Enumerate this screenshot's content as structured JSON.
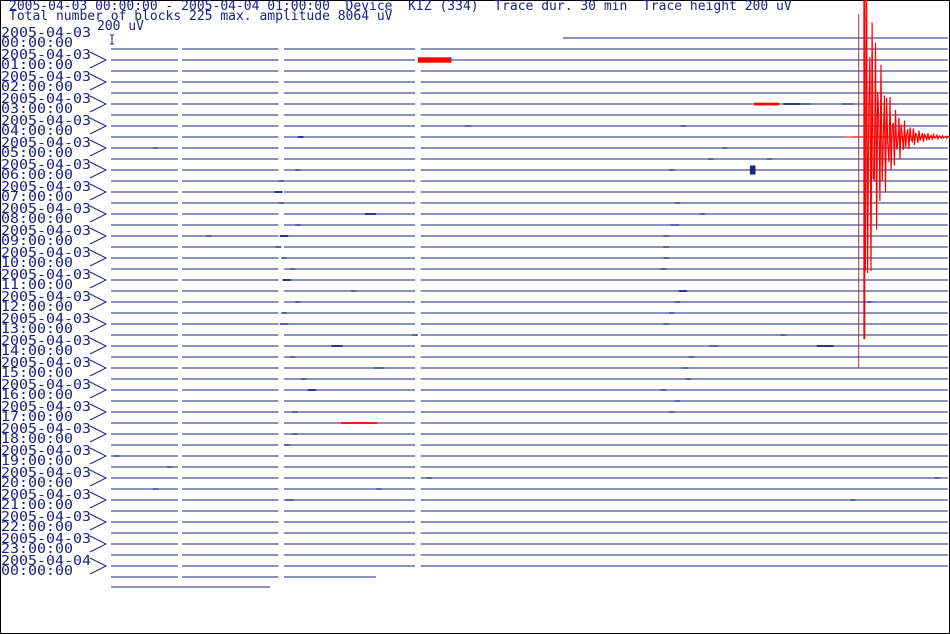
{
  "header": {
    "line1": "2005-04-03 00:00:00 - 2005-04-04 01:00:00  Device  KIZ (334)  Trace dur. 30 min  Trace height 200 uV",
    "line2": "Total number of blocks 225 max. amplitude 8064 uV"
  },
  "scale_bar": {
    "label": "200 uV"
  },
  "colors": {
    "trace": "#1a237e",
    "event": "#ff0000",
    "marker": "#a0304a",
    "text": "#1a237e",
    "frame": "#000000"
  },
  "chart_data": {
    "type": "line",
    "title": "",
    "xlabel": "",
    "ylabel": "",
    "trace_duration_min": 30,
    "trace_height_uV": 200,
    "xlim": [
      0,
      30
    ],
    "hour_labels": [
      [
        "2005-04-03",
        "00:00:00"
      ],
      [
        "2005-04-03",
        "01:00:00"
      ],
      [
        "2005-04-03",
        "02:00:00"
      ],
      [
        "2005-04-03",
        "03:00:00"
      ],
      [
        "2005-04-03",
        "04:00:00"
      ],
      [
        "2005-04-03",
        "05:00:00"
      ],
      [
        "2005-04-03",
        "06:00:00"
      ],
      [
        "2005-04-03",
        "07:00:00"
      ],
      [
        "2005-04-03",
        "08:00:00"
      ],
      [
        "2005-04-03",
        "09:00:00"
      ],
      [
        "2005-04-03",
        "10:00:00"
      ],
      [
        "2005-04-03",
        "11:00:00"
      ],
      [
        "2005-04-03",
        "12:00:00"
      ],
      [
        "2005-04-03",
        "13:00:00"
      ],
      [
        "2005-04-03",
        "14:00:00"
      ],
      [
        "2005-04-03",
        "15:00:00"
      ],
      [
        "2005-04-03",
        "16:00:00"
      ],
      [
        "2005-04-03",
        "17:00:00"
      ],
      [
        "2005-04-03",
        "18:00:00"
      ],
      [
        "2005-04-03",
        "19:00:00"
      ],
      [
        "2005-04-03",
        "20:00:00"
      ],
      [
        "2005-04-03",
        "21:00:00"
      ],
      [
        "2005-04-03",
        "22:00:00"
      ],
      [
        "2005-04-03",
        "23:00:00"
      ],
      [
        "2005-04-04",
        "00:00:00"
      ]
    ],
    "trace_count": 50,
    "data_gaps_min": [
      [
        2.4,
        2.55
      ],
      [
        6.0,
        6.2
      ],
      [
        10.9,
        11.1
      ]
    ],
    "marker_time_min": 26.8,
    "events": [
      {
        "trace": 2,
        "min": 11.6,
        "amp": 12,
        "width": 1.2,
        "red": true
      },
      {
        "trace": 6,
        "min": 23.5,
        "amp": 6,
        "width": 0.9,
        "red": true
      },
      {
        "trace": 6,
        "min": 24.4,
        "amp": 4,
        "width": 0.6
      },
      {
        "trace": 6,
        "min": 24.9,
        "amp": 3,
        "width": 0.4
      },
      {
        "trace": 6,
        "min": 26.4,
        "amp": 3,
        "width": 0.4
      },
      {
        "trace": 9,
        "min": 27.0,
        "amp": 760,
        "width": 3.0,
        "red": true
      },
      {
        "trace": 8,
        "min": 12.8,
        "amp": 3,
        "width": 0.2
      },
      {
        "trace": 8,
        "min": 20.5,
        "amp": 3,
        "width": 0.2
      },
      {
        "trace": 9,
        "min": 6.8,
        "amp": 4,
        "width": 0.2
      },
      {
        "trace": 10,
        "min": 1.6,
        "amp": 3,
        "width": 0.2
      },
      {
        "trace": 10,
        "min": 22.0,
        "amp": 3,
        "width": 0.2
      },
      {
        "trace": 11,
        "min": 21.5,
        "amp": 3,
        "width": 0.2
      },
      {
        "trace": 11,
        "min": 23.6,
        "amp": 3,
        "width": 0.2
      },
      {
        "trace": 12,
        "min": 6.7,
        "amp": 3,
        "width": 0.2
      },
      {
        "trace": 12,
        "min": 20.1,
        "amp": 3,
        "width": 0.2
      },
      {
        "trace": 12,
        "min": 23.0,
        "amp": 20,
        "width": 0.2
      },
      {
        "trace": 13,
        "min": 6.1,
        "amp": 3,
        "width": 0.2
      },
      {
        "trace": 14,
        "min": 6.0,
        "amp": 4,
        "width": 0.3
      },
      {
        "trace": 15,
        "min": 6.1,
        "amp": 3,
        "width": 0.2
      },
      {
        "trace": 15,
        "min": 20.3,
        "amp": 3,
        "width": 0.2
      },
      {
        "trace": 16,
        "min": 9.3,
        "amp": 4,
        "width": 0.4
      },
      {
        "trace": 16,
        "min": 21.2,
        "amp": 3,
        "width": 0.2
      },
      {
        "trace": 17,
        "min": 6.7,
        "amp": 3,
        "width": 0.2
      },
      {
        "trace": 17,
        "min": 20.2,
        "amp": 3,
        "width": 0.3
      },
      {
        "trace": 18,
        "min": 3.5,
        "amp": 3,
        "width": 0.2
      },
      {
        "trace": 18,
        "min": 6.2,
        "amp": 4,
        "width": 0.3
      },
      {
        "trace": 18,
        "min": 19.9,
        "amp": 3,
        "width": 0.2
      },
      {
        "trace": 19,
        "min": 6.0,
        "amp": 3,
        "width": 0.2
      },
      {
        "trace": 19,
        "min": 19.9,
        "amp": 3,
        "width": 0.2
      },
      {
        "trace": 20,
        "min": 6.2,
        "amp": 3,
        "width": 0.2
      },
      {
        "trace": 20,
        "min": 19.9,
        "amp": 3,
        "width": 0.2
      },
      {
        "trace": 21,
        "min": 6.5,
        "amp": 3,
        "width": 0.2
      },
      {
        "trace": 21,
        "min": 19.8,
        "amp": 3,
        "width": 0.2
      },
      {
        "trace": 22,
        "min": 6.3,
        "amp": 4,
        "width": 0.3
      },
      {
        "trace": 23,
        "min": 8.7,
        "amp": 3,
        "width": 0.2
      },
      {
        "trace": 23,
        "min": 20.5,
        "amp": 4,
        "width": 0.3
      },
      {
        "trace": 24,
        "min": 6.7,
        "amp": 3,
        "width": 0.2
      },
      {
        "trace": 24,
        "min": 20.3,
        "amp": 3,
        "width": 0.2
      },
      {
        "trace": 24,
        "min": 27.2,
        "amp": 3,
        "width": 0.2
      },
      {
        "trace": 25,
        "min": 6.2,
        "amp": 3,
        "width": 0.2
      },
      {
        "trace": 25,
        "min": 20.1,
        "amp": 3,
        "width": 0.2
      },
      {
        "trace": 26,
        "min": 6.2,
        "amp": 3,
        "width": 0.3
      },
      {
        "trace": 26,
        "min": 19.9,
        "amp": 3,
        "width": 0.2
      },
      {
        "trace": 27,
        "min": 10.9,
        "amp": 3,
        "width": 0.2
      },
      {
        "trace": 27,
        "min": 24.1,
        "amp": 3,
        "width": 0.2
      },
      {
        "trace": 28,
        "min": 8.1,
        "amp": 4,
        "width": 0.4
      },
      {
        "trace": 28,
        "min": 21.6,
        "amp": 3,
        "width": 0.3
      },
      {
        "trace": 28,
        "min": 25.6,
        "amp": 4,
        "width": 0.6
      },
      {
        "trace": 29,
        "min": 6.5,
        "amp": 3,
        "width": 0.2
      },
      {
        "trace": 29,
        "min": 20.8,
        "amp": 3,
        "width": 0.2
      },
      {
        "trace": 30,
        "min": 9.6,
        "amp": 3,
        "width": 0.4
      },
      {
        "trace": 30,
        "min": 20.6,
        "amp": 3,
        "width": 0.2
      },
      {
        "trace": 31,
        "min": 6.9,
        "amp": 3,
        "width": 0.2
      },
      {
        "trace": 31,
        "min": 20.7,
        "amp": 3,
        "width": 0.2
      },
      {
        "trace": 32,
        "min": 7.2,
        "amp": 4,
        "width": 0.3
      },
      {
        "trace": 32,
        "min": 19.8,
        "amp": 3,
        "width": 0.2
      },
      {
        "trace": 33,
        "min": 20.3,
        "amp": 3,
        "width": 0.2
      },
      {
        "trace": 34,
        "min": 6.6,
        "amp": 3,
        "width": 0.2
      },
      {
        "trace": 34,
        "min": 20.1,
        "amp": 3,
        "width": 0.2
      },
      {
        "trace": 35,
        "min": 8.9,
        "amp": 4,
        "width": 1.3,
        "red": true
      },
      {
        "trace": 36,
        "min": 6.6,
        "amp": 3,
        "width": 0.2
      },
      {
        "trace": 37,
        "min": 6.3,
        "amp": 3,
        "width": 0.2
      },
      {
        "trace": 38,
        "min": 0.2,
        "amp": 3,
        "width": 0.2
      },
      {
        "trace": 39,
        "min": 2.1,
        "amp": 3,
        "width": 0.2
      },
      {
        "trace": 40,
        "min": 11.4,
        "amp": 3,
        "width": 0.2
      },
      {
        "trace": 40,
        "min": 29.6,
        "amp": 3,
        "width": 0.2
      },
      {
        "trace": 41,
        "min": 1.6,
        "amp": 3,
        "width": 0.2
      },
      {
        "trace": 41,
        "min": 9.6,
        "amp": 3,
        "width": 0.2
      },
      {
        "trace": 42,
        "min": 6.4,
        "amp": 3,
        "width": 0.3
      },
      {
        "trace": 42,
        "min": 26.6,
        "amp": 3,
        "width": 0.2
      }
    ]
  }
}
